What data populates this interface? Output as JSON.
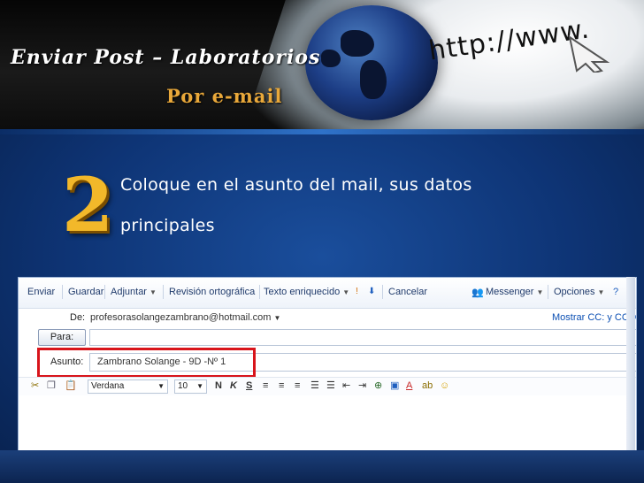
{
  "slide": {
    "title": "Enviar Post – Laboratorios",
    "subtitle": "Por  e-mail",
    "banner_url": "http://www.",
    "step_number": "2",
    "instruction_line1": "Coloque en el asunto del mail, sus datos",
    "instruction_line2": "principales",
    "accent_color": "#f2b82a",
    "highlight_color": "#d8141b"
  },
  "email": {
    "toolbar": {
      "send": "Enviar",
      "save": "Guardar",
      "attach": "Adjuntar",
      "spellcheck": "Revisión ortográfica",
      "rich_text": "Texto enriquecido",
      "cancel": "Cancelar",
      "messenger": "Messenger",
      "options": "Opciones"
    },
    "from_label": "De:",
    "from_value": "profesorasolangezambrano@hotmail.com",
    "show_cc_bcc": "Mostrar CC: y CCO",
    "to_button": "Para:",
    "to_value": "",
    "subject_label": "Asunto:",
    "subject_value": "Zambrano Solange - 9D -Nº 1",
    "font_name": "Verdana",
    "font_size": "10"
  }
}
